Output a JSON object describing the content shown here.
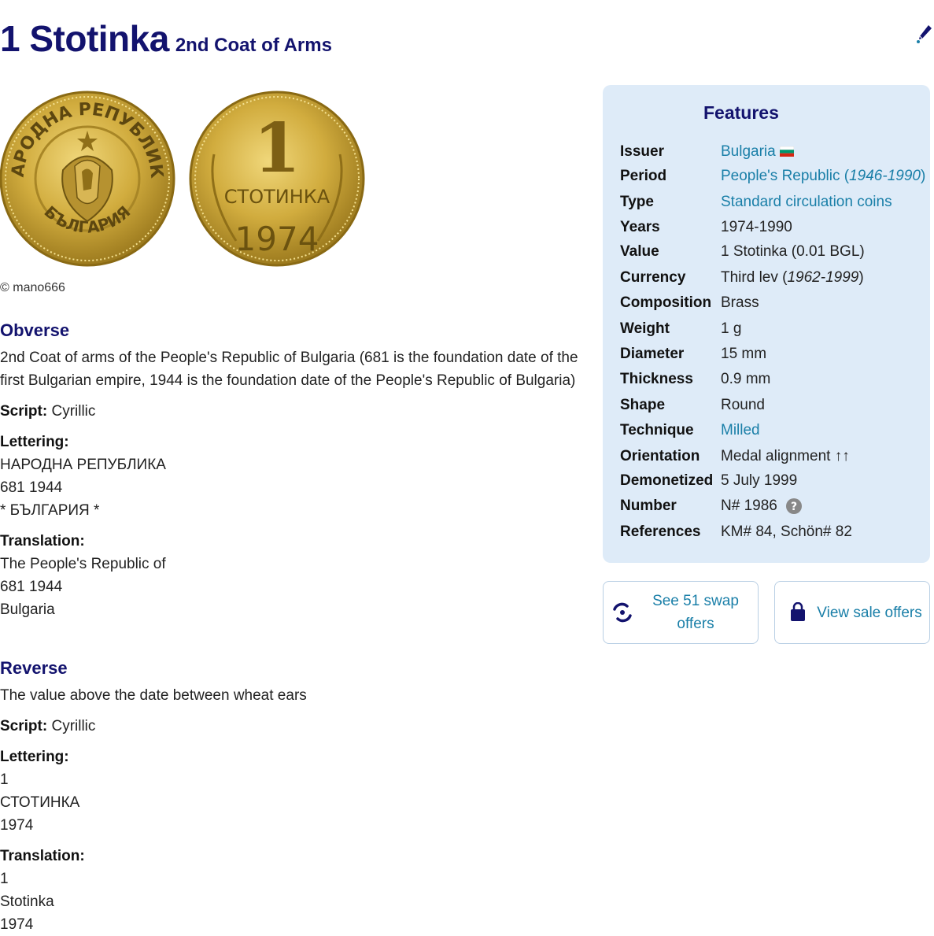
{
  "header": {
    "title": "1 Stotinka",
    "subtitle": "2nd Coat of Arms"
  },
  "image": {
    "obverse_text": "НАРОДНА РЕПУБЛИКА",
    "obverse_bottom": "БЪЛГАРИЯ",
    "reverse_value": "1",
    "reverse_word": "СТОТИНКА",
    "reverse_year": "1974",
    "credit": "© mano666"
  },
  "obverse": {
    "heading": "Obverse",
    "description": "2nd Coat of arms of the People's Republic of Bulgaria (681 is the foundation date of the first Bulgarian empire, 1944 is the foundation date of the People's Republic of Bulgaria)",
    "script_label": "Script:",
    "script": "Cyrillic",
    "lettering_label": "Lettering:",
    "lettering": [
      "НАРОДНА РЕПУБЛИКА",
      "681 1944",
      "* БЪЛГАРИЯ *"
    ],
    "translation_label": "Translation:",
    "translation": [
      "The People's Republic of",
      "681 1944",
      "Bulgaria"
    ]
  },
  "reverse": {
    "heading": "Reverse",
    "description": "The value above the date between wheat ears",
    "script_label": "Script:",
    "script": "Cyrillic",
    "lettering_label": "Lettering:",
    "lettering": [
      "1",
      "СТОТИНКА",
      "1974"
    ],
    "translation_label": "Translation:",
    "translation": [
      "1",
      "Stotinka",
      "1974"
    ]
  },
  "features": {
    "title": "Features",
    "issuer_label": "Issuer",
    "issuer": "Bulgaria",
    "period_label": "Period",
    "period": "People's Republic",
    "period_years": "1946-1990",
    "type_label": "Type",
    "type": "Standard circulation coins",
    "years_label": "Years",
    "years": "1974-1990",
    "value_label": "Value",
    "value": "1 Stotinka (0.01 BGL)",
    "currency_label": "Currency",
    "currency": "Third lev",
    "currency_years": "1962-1999",
    "composition_label": "Composition",
    "composition": "Brass",
    "weight_label": "Weight",
    "weight": "1 g",
    "diameter_label": "Diameter",
    "diameter": "15 mm",
    "thickness_label": "Thickness",
    "thickness": "0.9 mm",
    "shape_label": "Shape",
    "shape": "Round",
    "technique_label": "Technique",
    "technique": "Milled",
    "orientation_label": "Orientation",
    "orientation": "Medal alignment ↑↑",
    "demonetized_label": "Demonetized",
    "demonetized": "5 July 1999",
    "number_label": "Number",
    "number": "N# 1986",
    "references_label": "References",
    "references": "KM# 84, Schön# 82"
  },
  "actions": {
    "swap_line1": "See 51 swap",
    "swap_line2": "offers",
    "sale": "View sale offers"
  },
  "colors": {
    "heading": "#13136e",
    "link": "#1a7fa8",
    "panel": "#deebf8",
    "coin_gold": "#c9a233"
  }
}
